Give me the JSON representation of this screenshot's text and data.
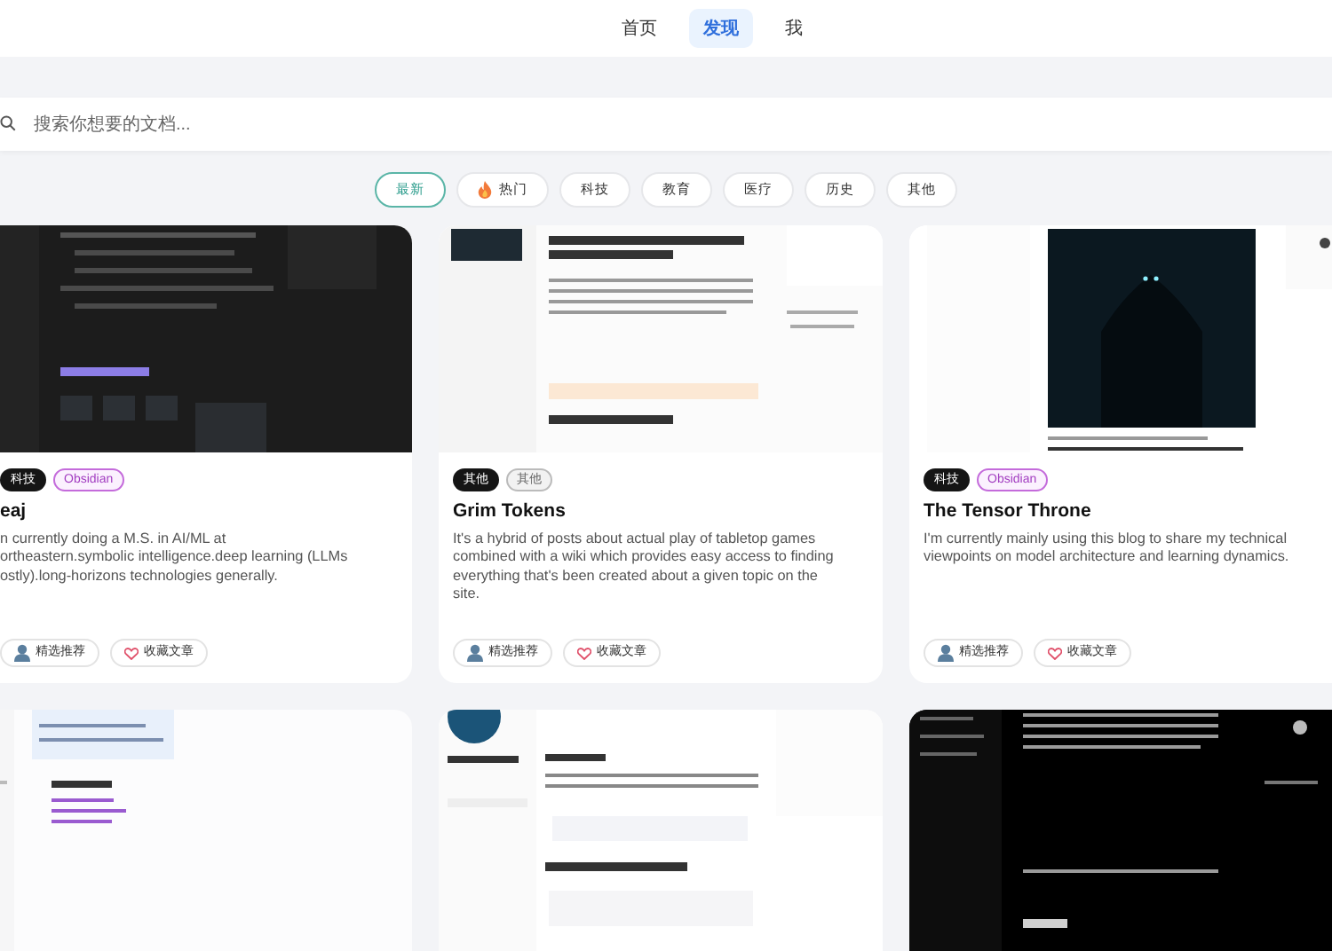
{
  "nav": [
    {
      "label": "首页",
      "selected": false
    },
    {
      "label": "发现",
      "selected": true
    },
    {
      "label": "我",
      "selected": false
    }
  ],
  "search": {
    "placeholder": "搜索你想要的文档..."
  },
  "filters": [
    {
      "label": "最新",
      "selected": true,
      "kind": "plain"
    },
    {
      "label": "热门",
      "selected": false,
      "kind": "hot"
    },
    {
      "label": "科技",
      "selected": false,
      "kind": "plain"
    },
    {
      "label": "教育",
      "selected": false,
      "kind": "plain"
    },
    {
      "label": "医疗",
      "selected": false,
      "kind": "plain"
    },
    {
      "label": "历史",
      "selected": false,
      "kind": "plain"
    },
    {
      "label": "其他",
      "selected": false,
      "kind": "plain"
    }
  ],
  "cards": [
    {
      "thumbnail": {
        "kind": "picture"
      },
      "tags": [
        {
          "label": "科技",
          "kind": "solid"
        },
        {
          "label": "Obsidian",
          "kind": "accent"
        }
      ],
      "title": "eaj",
      "description": [
        "n currently doing a M.S. in AI/ML at",
        "ortheastern.symbolic intelligence.deep learning (LLMs",
        "ostly).long-horizons technologies generally."
      ],
      "actions": [
        {
          "label": "精选推荐",
          "kind": "recommend"
        },
        {
          "label": "收藏文章",
          "kind": "favorite"
        }
      ]
    },
    {
      "thumbnail": {
        "kind": "picture"
      },
      "tags": [
        {
          "label": "其他",
          "kind": "solid"
        },
        {
          "label": "其他",
          "kind": "muted"
        }
      ],
      "title": "Grim Tokens",
      "description": [
        "It's a hybrid of posts about actual play of tabletop games",
        "combined with a wiki which provides easy access to finding",
        "everything that's been created about a given topic on the",
        "site."
      ],
      "actions": [
        {
          "label": "精选推荐",
          "kind": "recommend"
        },
        {
          "label": "收藏文章",
          "kind": "favorite"
        }
      ]
    },
    {
      "thumbnail": {
        "kind": "picture"
      },
      "tags": [
        {
          "label": "科技",
          "kind": "solid"
        },
        {
          "label": "Obsidian",
          "kind": "accent"
        }
      ],
      "title": "The Tensor Throne",
      "description": [
        "I'm currently mainly using this blog to share my technical",
        "viewpoints on model architecture and learning dynamics."
      ],
      "actions": [
        {
          "label": "精选推荐",
          "kind": "recommend"
        },
        {
          "label": "收藏文章",
          "kind": "favorite"
        }
      ]
    },
    {
      "thumbnail": {
        "kind": "picture"
      }
    },
    {
      "thumbnail": {
        "kind": "picture"
      }
    },
    {
      "thumbnail": {
        "kind": "picture"
      }
    }
  ]
}
